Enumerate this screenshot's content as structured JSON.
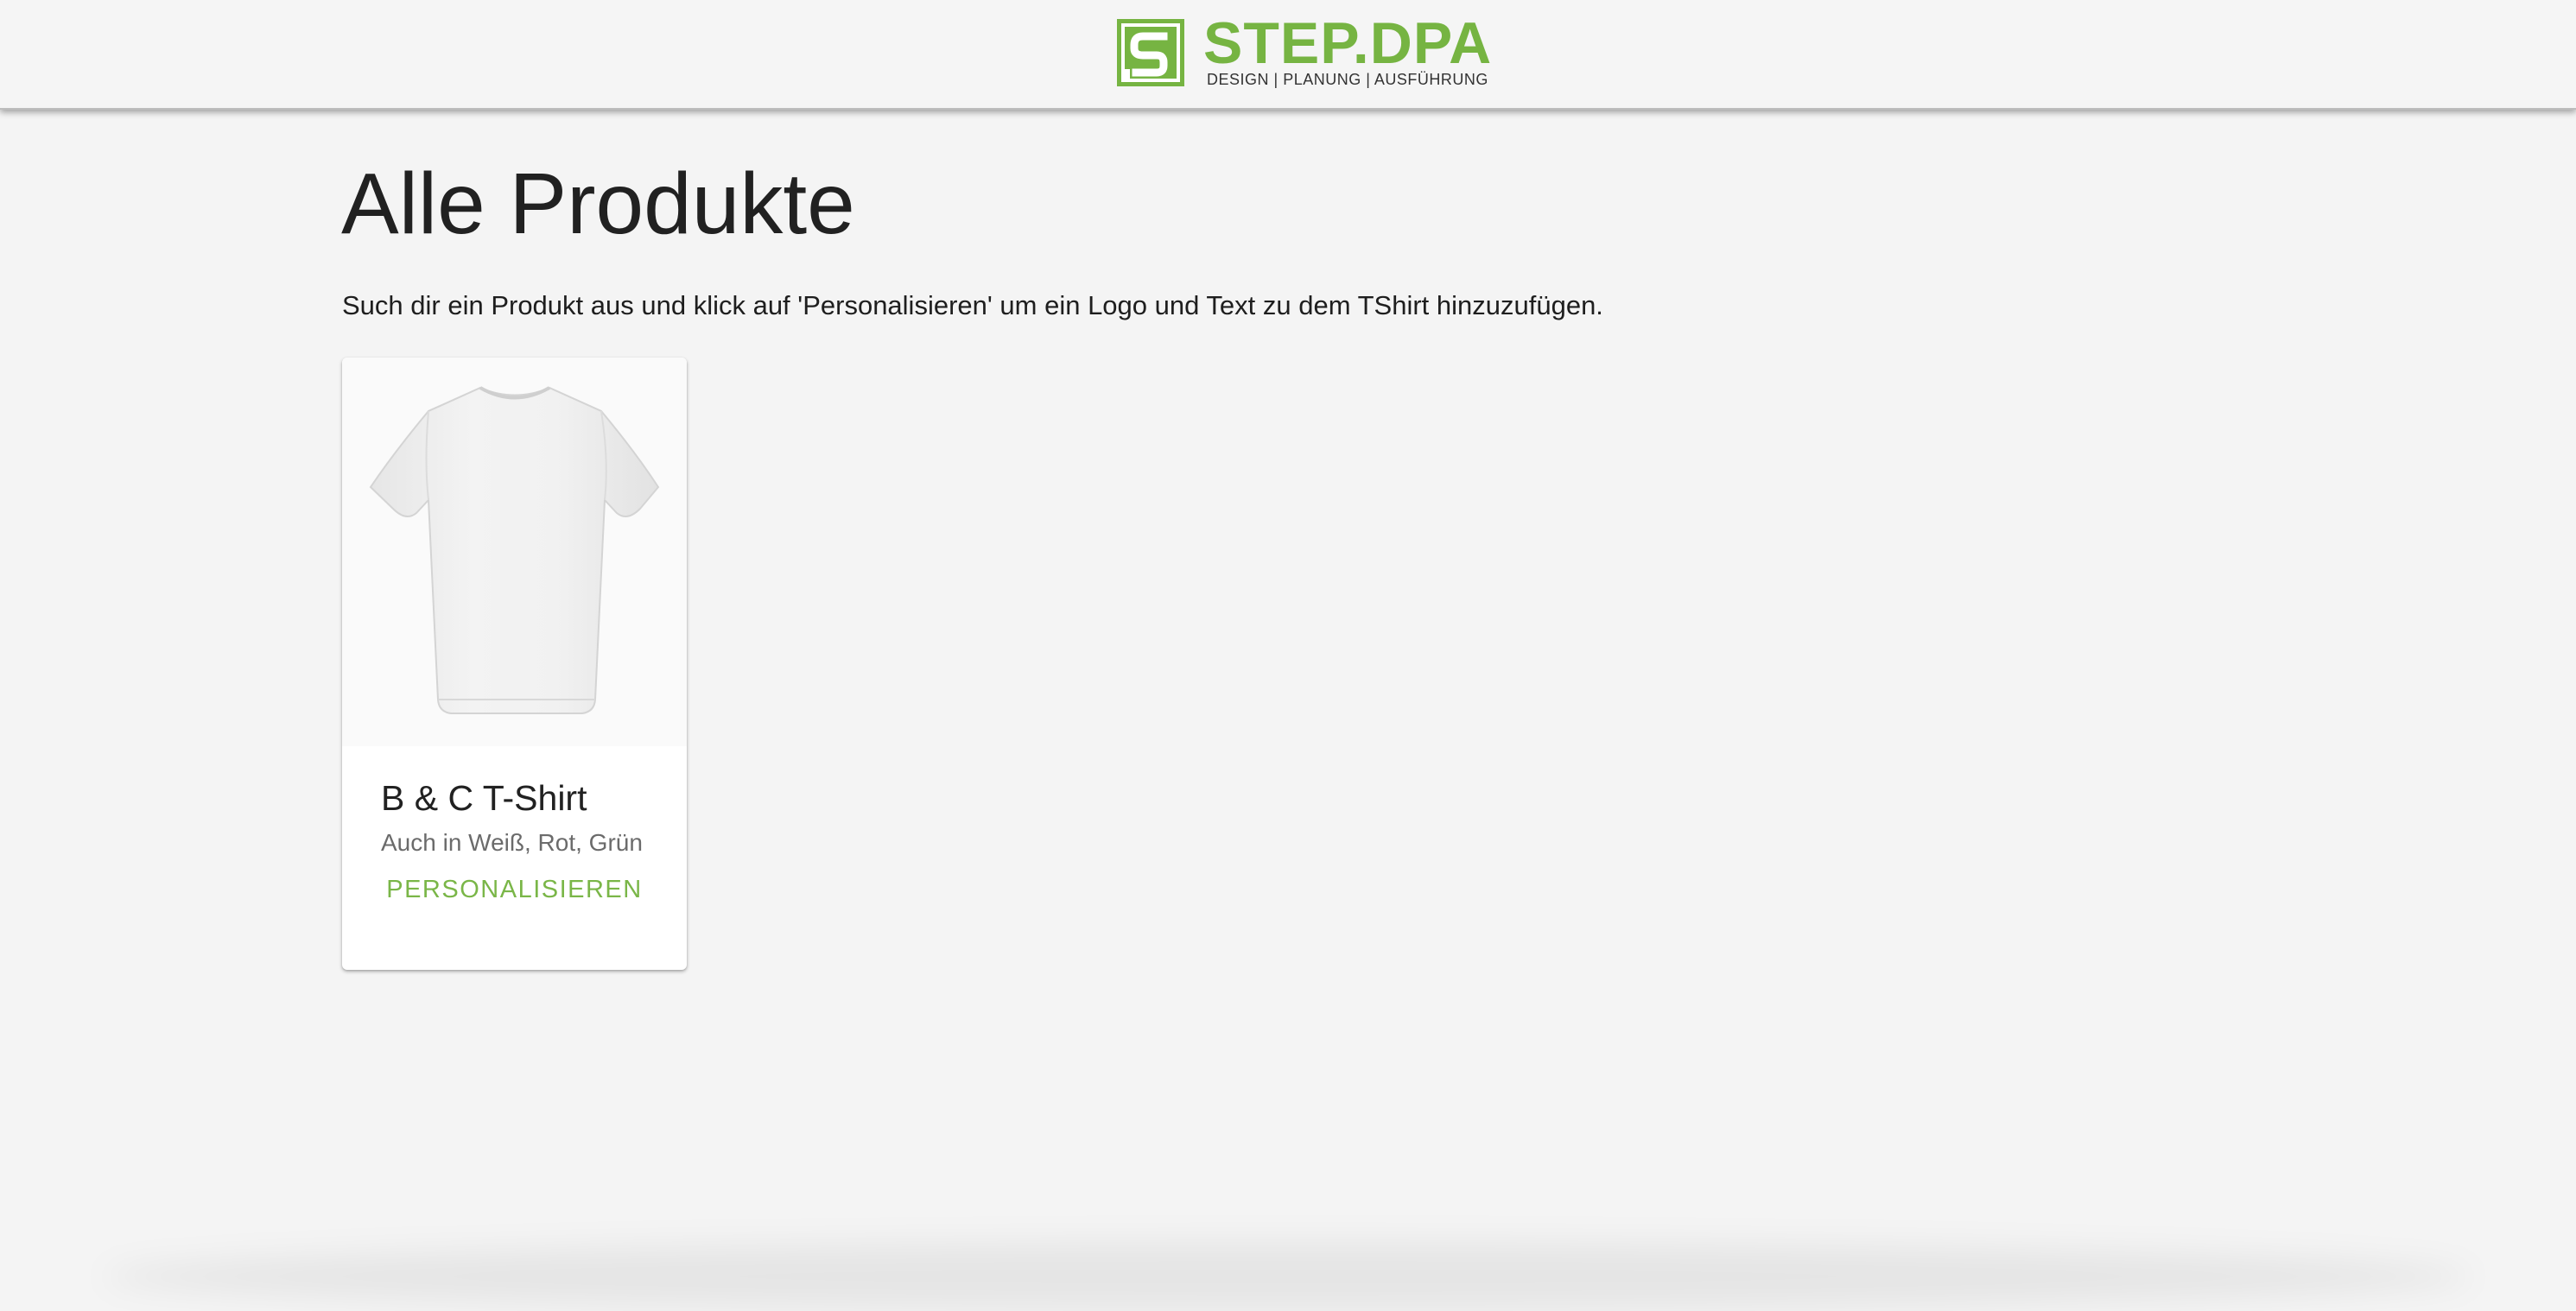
{
  "header": {
    "logo_word": "STEP.DPA",
    "logo_tagline": "DESIGN | PLANUNG | AUSFÜHRUNG",
    "brand_color": "#76b442"
  },
  "main": {
    "title": "Alle Produkte",
    "subtitle": "Such dir ein Produkt aus und klick auf 'Personalisieren' um ein Logo und Text zu dem TShirt hinzuzufügen."
  },
  "products": [
    {
      "name": "B & C T-Shirt",
      "description": "Auch in Weiß, Rot, Grün",
      "action_label": "PERSONALISIEREN",
      "image_icon": "white-tshirt"
    }
  ],
  "colors": {
    "background": "#f4f4f4",
    "card": "#ffffff",
    "accent": "#7ab648"
  }
}
